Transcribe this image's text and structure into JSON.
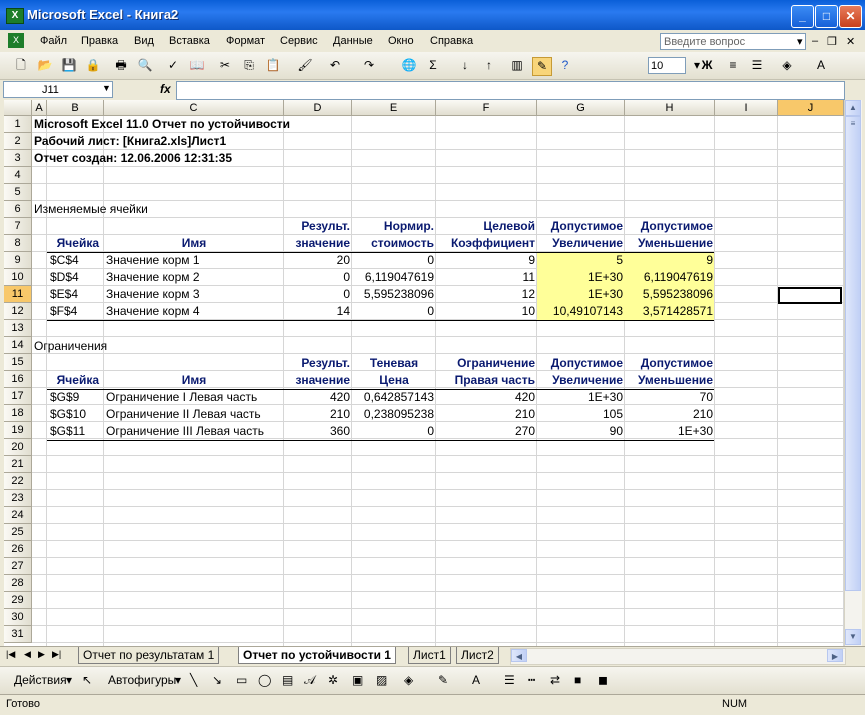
{
  "window": {
    "title": "Microsoft Excel - Книга2"
  },
  "menu": {
    "items": [
      "Файл",
      "Правка",
      "Вид",
      "Вставка",
      "Формат",
      "Сервис",
      "Данные",
      "Окно",
      "Справка"
    ],
    "ask_placeholder": "Введите вопрос"
  },
  "toolbar": {
    "font_size": "10",
    "bold_label": "Ж"
  },
  "formula": {
    "name_box": "J11",
    "fx_label": "fx",
    "value": ""
  },
  "columns": [
    "A",
    "B",
    "C",
    "D",
    "E",
    "F",
    "G",
    "H",
    "I",
    "J"
  ],
  "rows": [
    "1",
    "2",
    "3",
    "4",
    "5",
    "6",
    "7",
    "8",
    "9",
    "10",
    "11",
    "12",
    "13",
    "14",
    "15",
    "16",
    "17",
    "18",
    "19",
    "20",
    "21",
    "22",
    "23",
    "24",
    "25",
    "26",
    "27",
    "28",
    "29",
    "30",
    "31"
  ],
  "report": {
    "line1": "Microsoft Excel 11.0 Отчет по устойчивости",
    "line2": "Рабочий лист: [Книга2.xls]Лист1",
    "line3": "Отчет создан: 12.06.2006 12:31:35",
    "changing_title": "Изменяемые ячейки",
    "changing_headers": {
      "row7": [
        "Результ.",
        "Нормир.",
        "Целевой",
        "Допустимое",
        "Допустимое"
      ],
      "cell": "Ячейка",
      "name": "Имя",
      "row8": [
        "значение",
        "стоимость",
        "Коэффициент",
        "Увеличение",
        "Уменьшение"
      ]
    },
    "changing_rows": [
      {
        "cell": "$C$4",
        "name": "Значение корм 1",
        "value": "20",
        "cost": "0",
        "coef": "9",
        "inc": "5",
        "dec": "9"
      },
      {
        "cell": "$D$4",
        "name": "Значение корм 2",
        "value": "0",
        "cost": "6,119047619",
        "coef": "11",
        "inc": "1E+30",
        "dec": "6,119047619"
      },
      {
        "cell": "$E$4",
        "name": "Значение корм 3",
        "value": "0",
        "cost": "5,595238096",
        "coef": "12",
        "inc": "1E+30",
        "dec": "5,595238096"
      },
      {
        "cell": "$F$4",
        "name": "Значение корм 4",
        "value": "14",
        "cost": "0",
        "coef": "10",
        "inc": "10,49107143",
        "dec": "3,571428571"
      }
    ],
    "constraints_title": "Ограничения",
    "constraint_headers": {
      "row15": [
        "Результ.",
        "Теневая",
        "Ограничение",
        "Допустимое",
        "Допустимое"
      ],
      "cell": "Ячейка",
      "name": "Имя",
      "row16": [
        "значение",
        "Цена",
        "Правая часть",
        "Увеличение",
        "Уменьшение"
      ]
    },
    "constraint_rows": [
      {
        "cell": "$G$9",
        "name": "Ограничение I Левая часть",
        "value": "420",
        "price": "0,642857143",
        "rhs": "420",
        "inc": "1E+30",
        "dec": "70"
      },
      {
        "cell": "$G$10",
        "name": "Ограничение II Левая часть",
        "value": "210",
        "price": "0,238095238",
        "rhs": "210",
        "inc": "105",
        "dec": "210"
      },
      {
        "cell": "$G$11",
        "name": "Ограничение III Левая часть",
        "value": "360",
        "price": "0",
        "rhs": "270",
        "inc": "90",
        "dec": "1E+30"
      }
    ]
  },
  "tabs": [
    "Отчет по результатам 1",
    "Отчет по устойчивости 1",
    "Лист1",
    "Лист2"
  ],
  "drawing": {
    "actions": "Действия",
    "autoshapes": "Автофигуры"
  },
  "status": {
    "text": "Готово",
    "num": "NUM"
  }
}
